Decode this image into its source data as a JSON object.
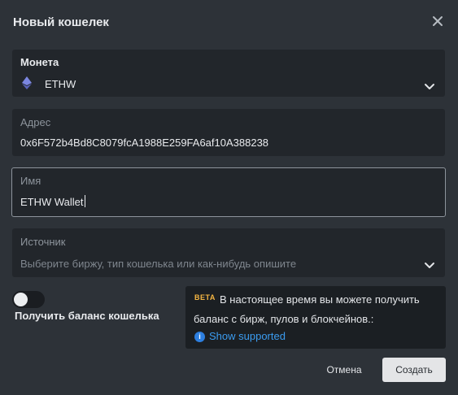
{
  "dialog": {
    "title": "Новый кошелек"
  },
  "coin": {
    "label": "Монета",
    "value": "ETHW",
    "icon": "ethereum-icon"
  },
  "address": {
    "label": "Адрес",
    "value": "0x6F572b4Bd8C8079fcA1988E259FA6af10A388238"
  },
  "name": {
    "label": "Имя",
    "value": "ETHW Wallet"
  },
  "source": {
    "label": "Источник",
    "placeholder": "Выберите биржу, тип кошелька или как-нибудь опишите"
  },
  "balance_toggle": {
    "label": "Получить баланс кошелька",
    "enabled": false
  },
  "beta_notice": {
    "badge": "BETA",
    "line1": "В настоящее время вы можете получить",
    "line2": "баланс с бирж, пулов и блокчейнов.:",
    "info_icon_glyph": "i",
    "link": "Show supported"
  },
  "actions": {
    "cancel": "Отмена",
    "create": "Создать"
  },
  "colors": {
    "background": "#2d3238",
    "field": "#22262b",
    "beta_badge": "#f5b642",
    "link": "#3b9cf0"
  }
}
